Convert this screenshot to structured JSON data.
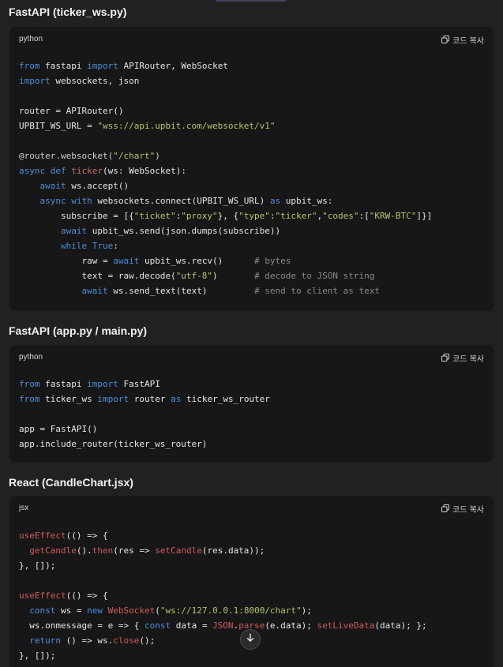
{
  "sections": [
    {
      "heading": "FastAPI (ticker_ws.py)",
      "lang": "python",
      "copy_label": "코드 복사",
      "lines": [
        [
          {
            "t": "from",
            "c": "kw"
          },
          {
            "t": " fastapi ",
            "c": "txt"
          },
          {
            "t": "import",
            "c": "kw"
          },
          {
            "t": " APIRouter, WebSocket",
            "c": "txt"
          }
        ],
        [
          {
            "t": "import",
            "c": "kw"
          },
          {
            "t": " websockets, json",
            "c": "txt"
          }
        ],
        [],
        [
          {
            "t": "router = APIRouter()",
            "c": "txt"
          }
        ],
        [
          {
            "t": "UPBIT_WS_URL = ",
            "c": "txt"
          },
          {
            "t": "\"wss://api.upbit.com/websocket/v1\"",
            "c": "str-py"
          }
        ],
        [],
        [
          {
            "t": "@router.websocket(",
            "c": "dec"
          },
          {
            "t": "\"/chart\"",
            "c": "str-py"
          },
          {
            "t": ")",
            "c": "dec"
          }
        ],
        [
          {
            "t": "async",
            "c": "kw"
          },
          {
            "t": " ",
            "c": "txt"
          },
          {
            "t": "def",
            "c": "kw"
          },
          {
            "t": " ",
            "c": "txt"
          },
          {
            "t": "ticker",
            "c": "fn"
          },
          {
            "t": "(ws: WebSocket):",
            "c": "txt"
          }
        ],
        [
          {
            "t": "    ",
            "c": "txt"
          },
          {
            "t": "await",
            "c": "kw"
          },
          {
            "t": " ws.accept()",
            "c": "txt"
          }
        ],
        [
          {
            "t": "    ",
            "c": "txt"
          },
          {
            "t": "async",
            "c": "kw"
          },
          {
            "t": " ",
            "c": "txt"
          },
          {
            "t": "with",
            "c": "kw"
          },
          {
            "t": " websockets.connect(UPBIT_WS_URL) ",
            "c": "txt"
          },
          {
            "t": "as",
            "c": "kw"
          },
          {
            "t": " upbit_ws:",
            "c": "txt"
          }
        ],
        [
          {
            "t": "        subscribe = [{",
            "c": "txt"
          },
          {
            "t": "\"ticket\"",
            "c": "str-py"
          },
          {
            "t": ":",
            "c": "txt"
          },
          {
            "t": "\"proxy\"",
            "c": "str-py"
          },
          {
            "t": "}, {",
            "c": "txt"
          },
          {
            "t": "\"type\"",
            "c": "str-py"
          },
          {
            "t": ":",
            "c": "txt"
          },
          {
            "t": "\"ticker\"",
            "c": "str-py"
          },
          {
            "t": ",",
            "c": "txt"
          },
          {
            "t": "\"codes\"",
            "c": "str-py"
          },
          {
            "t": ":[",
            "c": "txt"
          },
          {
            "t": "\"KRW-BTC\"",
            "c": "str-py"
          },
          {
            "t": "]}]",
            "c": "txt"
          }
        ],
        [
          {
            "t": "        ",
            "c": "txt"
          },
          {
            "t": "await",
            "c": "kw"
          },
          {
            "t": " upbit_ws.send(json.dumps(subscribe))",
            "c": "txt"
          }
        ],
        [
          {
            "t": "        ",
            "c": "txt"
          },
          {
            "t": "while",
            "c": "kw"
          },
          {
            "t": " ",
            "c": "txt"
          },
          {
            "t": "True",
            "c": "kw"
          },
          {
            "t": ":",
            "c": "txt"
          }
        ],
        [
          {
            "t": "            raw = ",
            "c": "txt"
          },
          {
            "t": "await",
            "c": "kw"
          },
          {
            "t": " upbit_ws.recv()      ",
            "c": "txt"
          },
          {
            "t": "# bytes",
            "c": "cm"
          }
        ],
        [
          {
            "t": "            text = raw.decode(",
            "c": "txt"
          },
          {
            "t": "\"utf-8\"",
            "c": "str-py"
          },
          {
            "t": ")       ",
            "c": "txt"
          },
          {
            "t": "# decode to JSON string",
            "c": "cm"
          }
        ],
        [
          {
            "t": "            ",
            "c": "txt"
          },
          {
            "t": "await",
            "c": "kw"
          },
          {
            "t": " ws.send_text(text)         ",
            "c": "txt"
          },
          {
            "t": "# send to client as text",
            "c": "cm"
          }
        ]
      ]
    },
    {
      "heading": "FastAPI (app.py / main.py)",
      "lang": "python",
      "copy_label": "코드 복사",
      "lines": [
        [
          {
            "t": "from",
            "c": "kw"
          },
          {
            "t": " fastapi ",
            "c": "txt"
          },
          {
            "t": "import",
            "c": "kw"
          },
          {
            "t": " FastAPI",
            "c": "txt"
          }
        ],
        [
          {
            "t": "from",
            "c": "kw"
          },
          {
            "t": " ticker_ws ",
            "c": "txt"
          },
          {
            "t": "import",
            "c": "kw"
          },
          {
            "t": " router ",
            "c": "txt"
          },
          {
            "t": "as",
            "c": "kw"
          },
          {
            "t": " ticker_ws_router",
            "c": "txt"
          }
        ],
        [],
        [
          {
            "t": "app = FastAPI()",
            "c": "txt"
          }
        ],
        [
          {
            "t": "app.include_router(ticker_ws_router)",
            "c": "txt"
          }
        ]
      ]
    },
    {
      "heading": "React (CandleChart.jsx)",
      "lang": "jsx",
      "copy_label": "코드 복사",
      "lines": [
        [
          {
            "t": "useEffect",
            "c": "fn2"
          },
          {
            "t": "(() => {",
            "c": "txt"
          }
        ],
        [
          {
            "t": "  ",
            "c": "txt"
          },
          {
            "t": "getCandle",
            "c": "fn2"
          },
          {
            "t": "().",
            "c": "txt"
          },
          {
            "t": "then",
            "c": "fn2"
          },
          {
            "t": "(res => ",
            "c": "txt"
          },
          {
            "t": "setCandle",
            "c": "fn2"
          },
          {
            "t": "(res.data));",
            "c": "txt"
          }
        ],
        [
          {
            "t": "}, []);",
            "c": "txt"
          }
        ],
        [],
        [
          {
            "t": "useEffect",
            "c": "fn2"
          },
          {
            "t": "(() => {",
            "c": "txt"
          }
        ],
        [
          {
            "t": "  ",
            "c": "txt"
          },
          {
            "t": "const",
            "c": "kw"
          },
          {
            "t": " ws = ",
            "c": "txt"
          },
          {
            "t": "new",
            "c": "kw"
          },
          {
            "t": " ",
            "c": "txt"
          },
          {
            "t": "WebSocket",
            "c": "fn2"
          },
          {
            "t": "(",
            "c": "txt"
          },
          {
            "t": "\"ws://127.0.0.1:8000/chart\"",
            "c": "str-jsx"
          },
          {
            "t": ");",
            "c": "txt"
          }
        ],
        [
          {
            "t": "  ws.onmessage = e => { ",
            "c": "txt"
          },
          {
            "t": "const",
            "c": "kw"
          },
          {
            "t": " data = ",
            "c": "txt"
          },
          {
            "t": "JSON",
            "c": "fn2"
          },
          {
            "t": ".",
            "c": "txt"
          },
          {
            "t": "parse",
            "c": "fn2"
          },
          {
            "t": "(e.data); ",
            "c": "txt"
          },
          {
            "t": "setLiveData",
            "c": "fn2"
          },
          {
            "t": "(data); };",
            "c": "txt"
          }
        ],
        [
          {
            "t": "  ",
            "c": "txt"
          },
          {
            "t": "return",
            "c": "kw"
          },
          {
            "t": " () => ws.",
            "c": "txt"
          },
          {
            "t": "close",
            "c": "fn2"
          },
          {
            "t": "();",
            "c": "txt"
          }
        ],
        [
          {
            "t": "}, []);",
            "c": "txt"
          }
        ]
      ]
    }
  ],
  "colors": {
    "page_bg": "#212121",
    "code_bg": "#171717",
    "keyword": "#4d8ddb",
    "string_python": "#b6c46e",
    "string_jsx": "#a9c46a",
    "comment": "#8a8a8a",
    "function_name": "#c86a6a"
  },
  "icons": {
    "copy": "copy-icon",
    "scroll_down": "arrow-down-icon"
  }
}
